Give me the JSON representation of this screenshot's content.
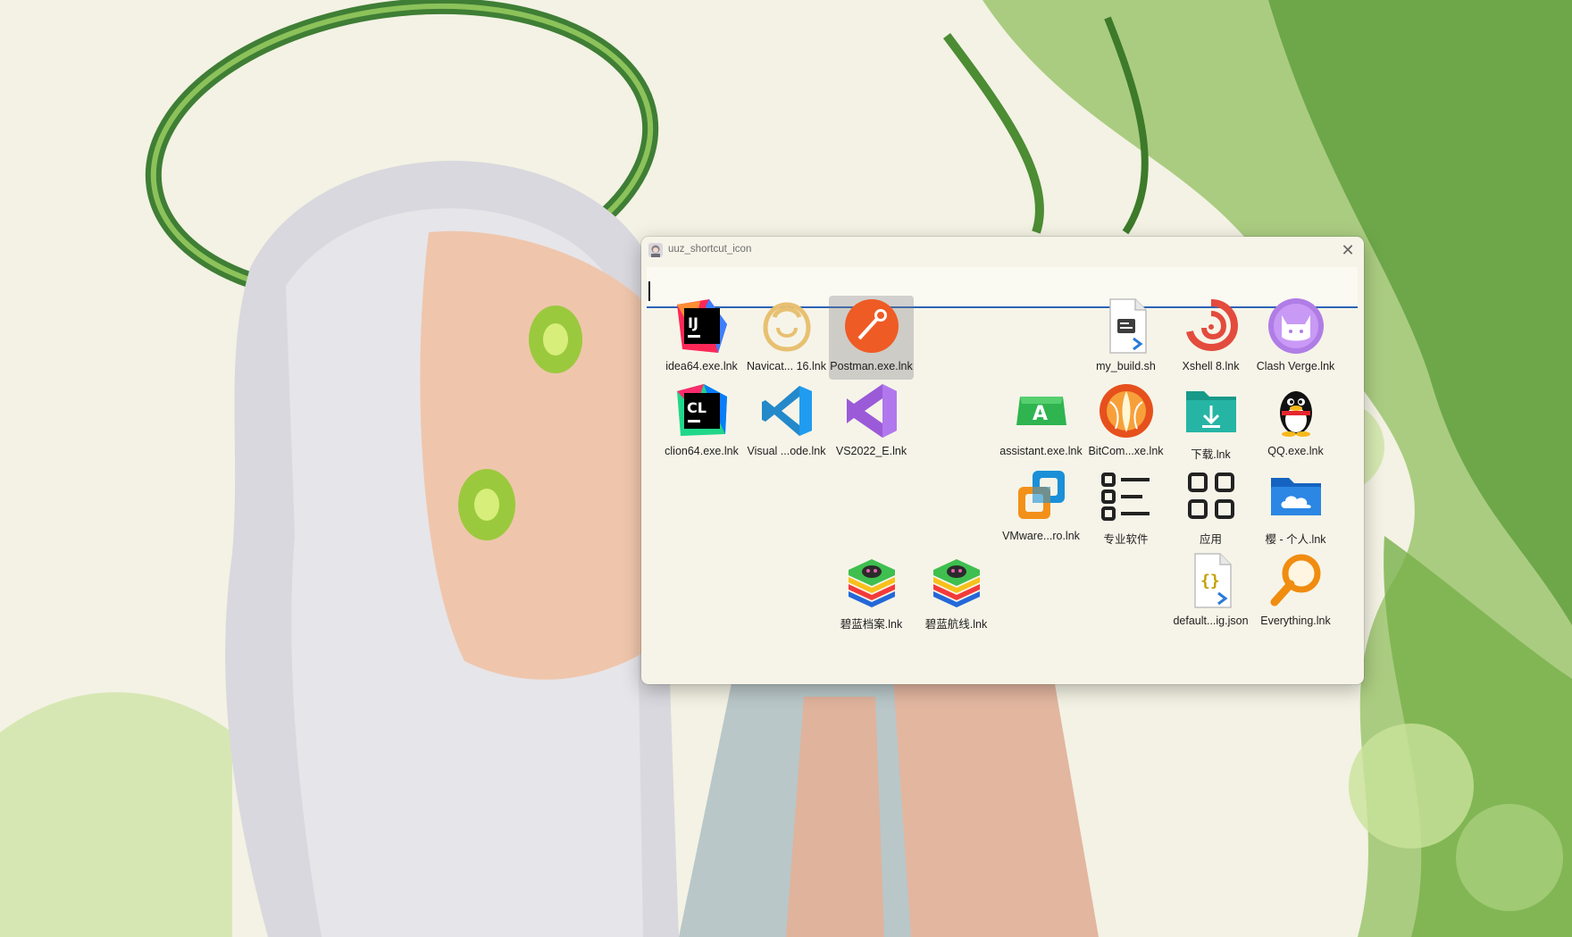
{
  "window": {
    "title": "uuz_shortcut_icon",
    "close_glyph": "✕",
    "search_value": ""
  },
  "tiles": [
    {
      "label": "idea64.exe.lnk",
      "icon": "intellij-idea-icon"
    },
    {
      "label": "Navicat... 16.lnk",
      "icon": "navicat-icon"
    },
    {
      "label": "Postman.exe.lnk",
      "icon": "postman-icon",
      "selected": true
    },
    {
      "label": "my_build.sh",
      "icon": "shell-script-file-icon"
    },
    {
      "label": "Xshell 8.lnk",
      "icon": "xshell-icon"
    },
    {
      "label": "Clash Verge.lnk",
      "icon": "clash-verge-icon"
    },
    {
      "label": "clion64.exe.lnk",
      "icon": "clion-icon"
    },
    {
      "label": "Visual ...ode.lnk",
      "icon": "vscode-icon"
    },
    {
      "label": "VS2022_E.lnk",
      "icon": "visual-studio-icon"
    },
    {
      "label": "assistant.exe.lnk",
      "icon": "assistant-icon"
    },
    {
      "label": "BitCom...xe.lnk",
      "icon": "bitcomet-icon"
    },
    {
      "label": "下载.lnk",
      "icon": "downloads-folder-icon"
    },
    {
      "label": "QQ.exe.lnk",
      "icon": "qq-penguin-icon"
    },
    {
      "label": "VMware...ro.lnk",
      "icon": "vmware-icon"
    },
    {
      "label": "专业软件",
      "icon": "list-folder-icon"
    },
    {
      "label": "应用",
      "icon": "apps-grid-icon"
    },
    {
      "label": "樱 - 个人.lnk",
      "icon": "onedrive-folder-icon"
    },
    {
      "label": "碧蓝档案.lnk",
      "icon": "bluestacks-icon"
    },
    {
      "label": "碧蓝航线.lnk",
      "icon": "bluestacks-icon"
    },
    {
      "label": "default...ig.json",
      "icon": "json-file-icon"
    },
    {
      "label": "Everything.lnk",
      "icon": "everything-search-icon"
    }
  ]
}
